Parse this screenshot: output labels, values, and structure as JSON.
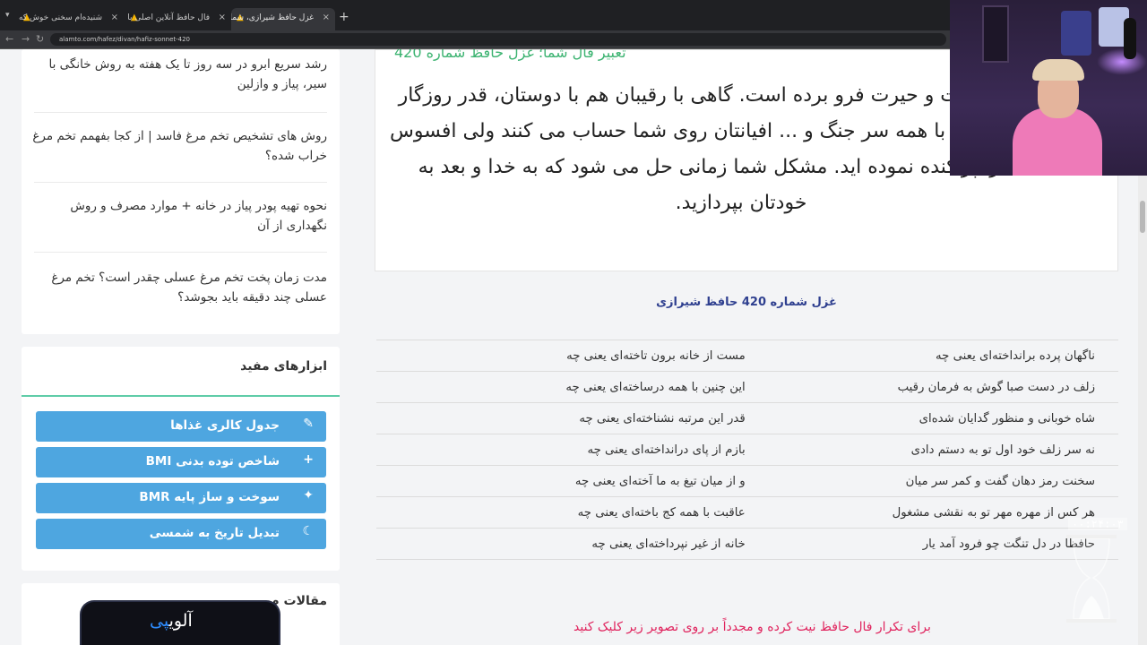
{
  "browser": {
    "tabs": [
      {
        "title": "شنیده‌ام سخنی خوش که پیر کنعان",
        "active": false
      },
      {
        "title": "فال حافظ آنلاین اصلی با تعبیر",
        "active": false
      },
      {
        "title": "غزل حافظ شیرازی، شماره 420 - آ",
        "active": true
      }
    ],
    "url": "alamto.com/hafez/divan/hafiz-sonnet-420"
  },
  "sidebar": {
    "related_links": [
      "رشد سریع ابرو در سه روز تا یک هفته به روش خانگی با سیر، پیاز و وازلین",
      "روش های تشخیص تخم مرغ فاسد | از کجا بفهمم تخم مرغ خراب شده؟",
      "نحوه تهیه پودر پیاز در خانه + موارد مصرف و روش نگهداری از آن",
      "مدت زمان پخت تخم مرغ عسلی چقدر است؟ تخم مرغ عسلی چند دقیقه باید بجوشد؟"
    ],
    "tools_title": "ابزارهای مفید",
    "tools": [
      {
        "label": "جدول کالری غذاها",
        "icon": "pencil-icon"
      },
      {
        "label": "شاخص توده بدنی BMI",
        "icon": "plus-icon"
      },
      {
        "label": "سوخت و ساز پایه BMR",
        "icon": "sparkle-icon"
      },
      {
        "label": "تبدیل تاریخ به شمسی",
        "icon": "moon-icon"
      }
    ],
    "articles_title": "مقالات م"
  },
  "main": {
    "card_heading": "تعبیر فال شما؛ غزل حافظ شماره 420",
    "fal_text": "... همه را در بهت و حیرت فرو برده است. گاهی با رقیبان هم با دوستان، قدر روزگار خود را نمی دانید. با همه سر جنگ و ... افیانتان روی شما حساب می کنند ولی افسوس که همه را پراکنده نموده اید. مشکل شما زمانی حل می شود که به خدا و بعد به خودتان بپردازید.",
    "poem_title": "غزل شماره 420 حافظ شیرازی",
    "poem": [
      {
        "m1": "ناگهان پرده برانداخته‌ای یعنی چه",
        "m2": "مست از خانه برون تاخته‌ای یعنی چه"
      },
      {
        "m1": "زلف در دست صبا گوش به فرمان رقیب",
        "m2": "این چنین با همه درساخته‌ای یعنی چه"
      },
      {
        "m1": "شاه خوبانی و منظور گدایان شده‌ای",
        "m2": "قدر این مرتبه نشناخته‌ای یعنی چه"
      },
      {
        "m1": "نه سر زلف خود اول تو به دستم دادی",
        "m2": "بازم از پای درانداخته‌ای یعنی چه"
      },
      {
        "m1": "سخنت رمز دهان گفت و کمر سر میان",
        "m2": "و از میان تیغ به ما آخته‌ای یعنی چه"
      },
      {
        "m1": "هر کس از مهره مهر تو به نقشی مشغول",
        "m2": "عاقبت با همه کج باخته‌ای یعنی چه"
      },
      {
        "m1": "حافظا در دل تنگت چو فرود آمد یار",
        "m2": "خانه از غیر نپرداخته‌ای یعنی چه"
      }
    ],
    "bottom_text": "برای تکرار فال حافظ نیت کرده و مجدداً بر روی تصویر زیر کلیک کنید"
  },
  "overlay": {
    "timer": "۰۰:۲۴:۰۳",
    "logo_main": "آلوی",
    "logo_accent": "پی"
  }
}
